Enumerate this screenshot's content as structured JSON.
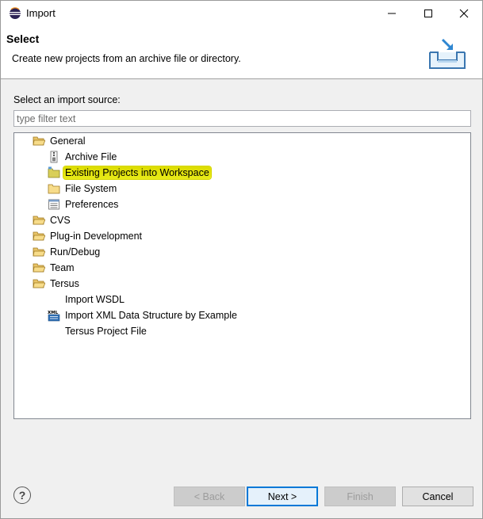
{
  "window": {
    "title": "Import",
    "icon": "eclipse-icon"
  },
  "header": {
    "title": "Select",
    "description": "Create new projects from an archive file or directory.",
    "icon": "import-wizard-icon"
  },
  "source": {
    "label": "Select an import source:",
    "filter_placeholder": "type filter text",
    "filter_value": ""
  },
  "tree": {
    "items": [
      {
        "label": "General",
        "icon": "folder-open-icon",
        "level": 0,
        "expanded": true
      },
      {
        "label": "Archive File",
        "icon": "archive-file-icon",
        "level": 1
      },
      {
        "label": "Existing Projects into Workspace",
        "icon": "project-folder-icon",
        "level": 1,
        "highlighted": true
      },
      {
        "label": "File System",
        "icon": "folder-icon",
        "level": 1
      },
      {
        "label": "Preferences",
        "icon": "preferences-icon",
        "level": 1
      },
      {
        "label": "CVS",
        "icon": "folder-closed-icon",
        "level": 0
      },
      {
        "label": "Plug-in Development",
        "icon": "folder-closed-icon",
        "level": 0
      },
      {
        "label": "Run/Debug",
        "icon": "folder-closed-icon",
        "level": 0
      },
      {
        "label": "Team",
        "icon": "folder-closed-icon",
        "level": 0
      },
      {
        "label": "Tersus",
        "icon": "folder-open-icon",
        "level": 0,
        "expanded": true
      },
      {
        "label": "Import WSDL",
        "icon": "none",
        "level": 1
      },
      {
        "label": "Import XML Data Structure by Example",
        "icon": "xml-icon",
        "level": 1
      },
      {
        "label": "Tersus Project File",
        "icon": "none",
        "level": 1
      }
    ]
  },
  "buttons": {
    "help": "?",
    "back": "< Back",
    "next": "Next >",
    "finish": "Finish",
    "cancel": "Cancel"
  },
  "colors": {
    "highlight": "#e2e41a",
    "default_button_border": "#0078d7",
    "folder": "#e8c468"
  }
}
